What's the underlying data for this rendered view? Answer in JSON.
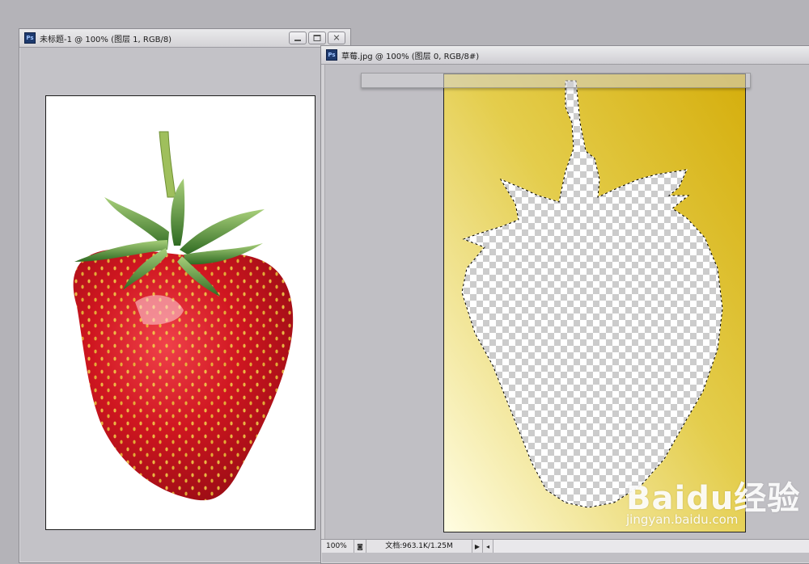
{
  "window1": {
    "title": "未标题-1 @ 100% (图层 1, RGB/8)",
    "app_icon": "Ps"
  },
  "window2": {
    "title": "草莓.jpg @ 100% (图层 0, RGB/8#)",
    "app_icon": "Ps"
  },
  "statusbar": {
    "zoom": "100%",
    "doc_size": "文档:963.1K/1.25M"
  },
  "watermark": {
    "logo": "Baidu经验",
    "url": "jingyan.baidu.com"
  },
  "colors": {
    "workspace": "#b4b3b8",
    "strawberry_red": "#c8141e",
    "leaf_green": "#4a8a2f",
    "background_yellow": "#d7b615",
    "background_light": "#fdfbd8"
  }
}
